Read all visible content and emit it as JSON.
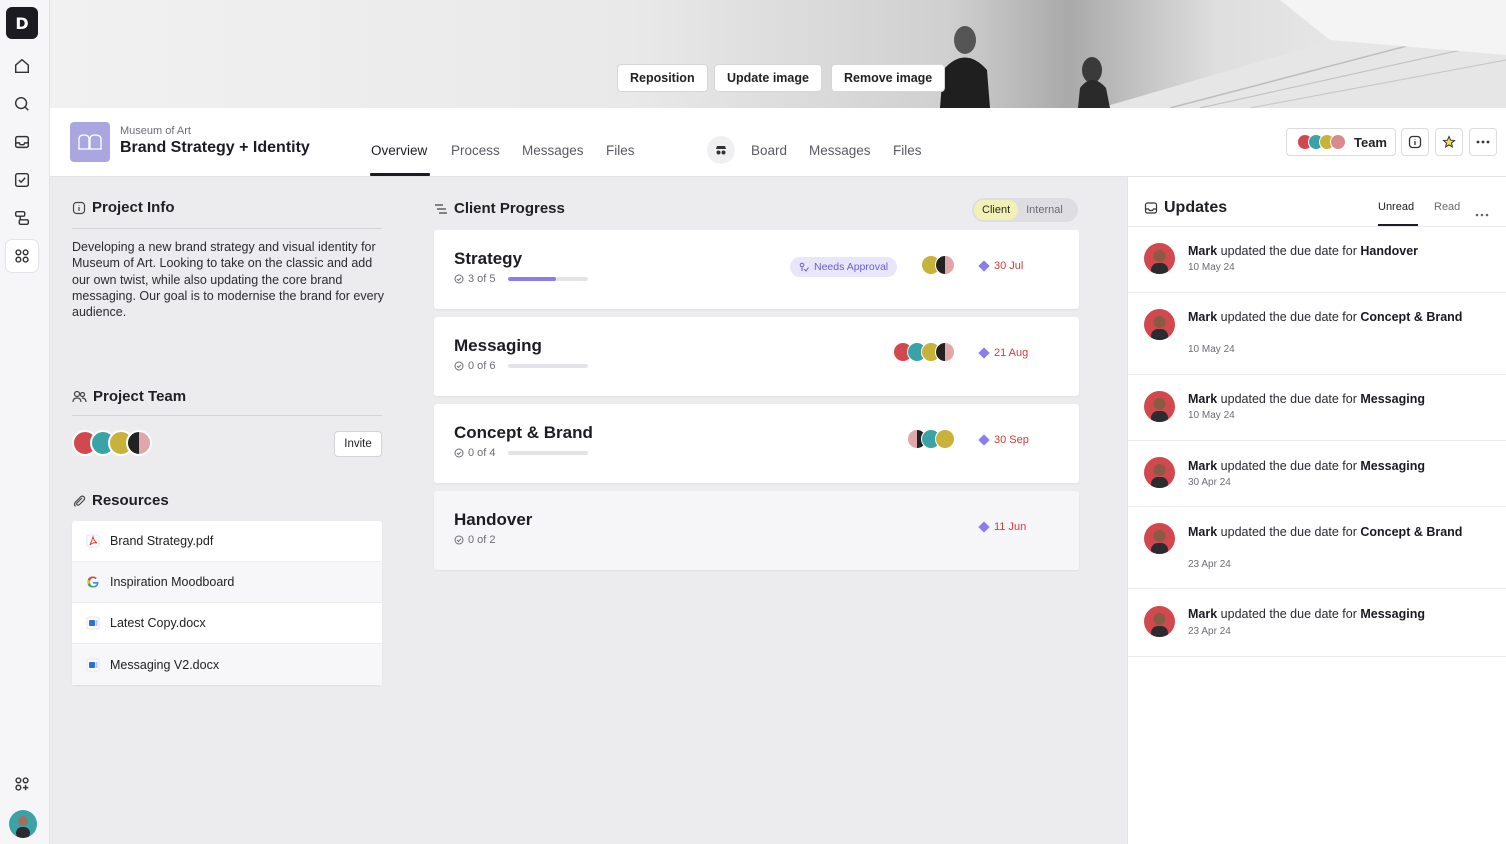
{
  "app": {
    "logo_letter": "D"
  },
  "banner": {
    "reposition_label": "Reposition",
    "update_label": "Update image",
    "remove_label": "Remove image"
  },
  "project": {
    "client": "Museum of Art",
    "name": "Brand Strategy + Identity"
  },
  "tabs_left": [
    "Overview",
    "Process",
    "Messages",
    "Files"
  ],
  "tabs_right": [
    "Board",
    "Messages",
    "Files"
  ],
  "header": {
    "team_label": "Team"
  },
  "project_info": {
    "title": "Project Info",
    "description": "Developing a new brand strategy and visual identity for Museum of Art. Looking to take on the classic and add our own twist, while also updating the core brand messaging. Our goal is to modernise the brand for every audience."
  },
  "project_team": {
    "title": "Project Team",
    "invite_label": "Invite"
  },
  "resources": {
    "title": "Resources",
    "items": [
      {
        "name": "Brand Strategy.pdf",
        "icon": "pdf-icon"
      },
      {
        "name": "Inspiration Moodboard",
        "icon": "google-icon"
      },
      {
        "name": "Latest Copy.docx",
        "icon": "word-icon"
      },
      {
        "name": "Messaging V2.docx",
        "icon": "word-icon"
      }
    ]
  },
  "client_progress": {
    "title": "Client Progress",
    "toggle": {
      "client": "Client",
      "internal": "Internal"
    },
    "stages": [
      {
        "title": "Strategy",
        "progress": "3 of 5",
        "fraction": 0.6,
        "badge": "Needs Approval",
        "due": "30 Jul"
      },
      {
        "title": "Messaging",
        "progress": "0 of 6",
        "fraction": 0,
        "badge": "",
        "due": "21 Aug"
      },
      {
        "title": "Concept & Brand",
        "progress": "0 of 4",
        "fraction": 0,
        "badge": "",
        "due": "30 Sep"
      },
      {
        "title": "Handover",
        "progress": "0 of 2",
        "fraction": 0,
        "badge": "",
        "due": "11 Jun"
      }
    ]
  },
  "updates": {
    "title": "Updates",
    "tab_unread": "Unread",
    "tab_read": "Read",
    "items": [
      {
        "user": "Mark",
        "action": " updated the due date for ",
        "target": "Handover",
        "date": "10 May 24"
      },
      {
        "user": "Mark",
        "action": " updated the due date for ",
        "target": "Concept & Brand",
        "date": "10 May 24"
      },
      {
        "user": "Mark",
        "action": " updated the due date for ",
        "target": "Messaging",
        "date": "10 May 24"
      },
      {
        "user": "Mark",
        "action": " updated the due date for ",
        "target": "Messaging",
        "date": "30 Apr 24"
      },
      {
        "user": "Mark",
        "action": " updated the due date for ",
        "target": "Concept & Brand",
        "date": "23 Apr 24"
      },
      {
        "user": "Mark",
        "action": " updated the due date for ",
        "target": "Messaging",
        "date": "23 Apr 24"
      }
    ]
  },
  "colors": {
    "accent": "#8b7cf0",
    "due": "#d23a3a",
    "badge_bg": "#e9e6fb",
    "toggle_sel": "#f2f1b5"
  }
}
